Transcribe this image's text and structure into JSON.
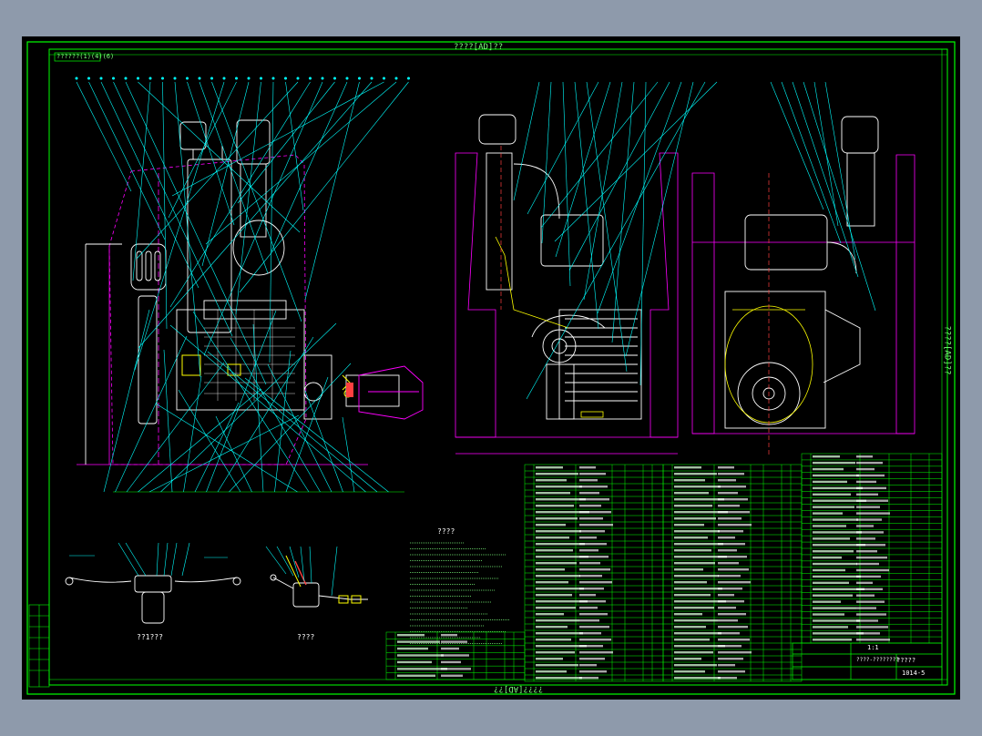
{
  "drawing": {
    "frame_title_top": "????[AD]??",
    "frame_title_bottom": "????[AD]??",
    "frame_title_right": "????[AD]??",
    "corner_label": "??????(1)(4)(6)",
    "detail_a_caption": "??1???",
    "detail_b_caption": "????",
    "notes_title": "????",
    "title_block": {
      "code": "?????",
      "scale": "1:1",
      "drawing_no": "1014-5",
      "company": "????-????????"
    },
    "colors": {
      "background": "#000000",
      "frame": "#00ff00",
      "engine_outline": "#ffffff",
      "leader_lines": "#00ffff",
      "reference_lines": "#ff00ff",
      "highlight": "#ffff00",
      "accent_red": "#ff4040"
    }
  }
}
